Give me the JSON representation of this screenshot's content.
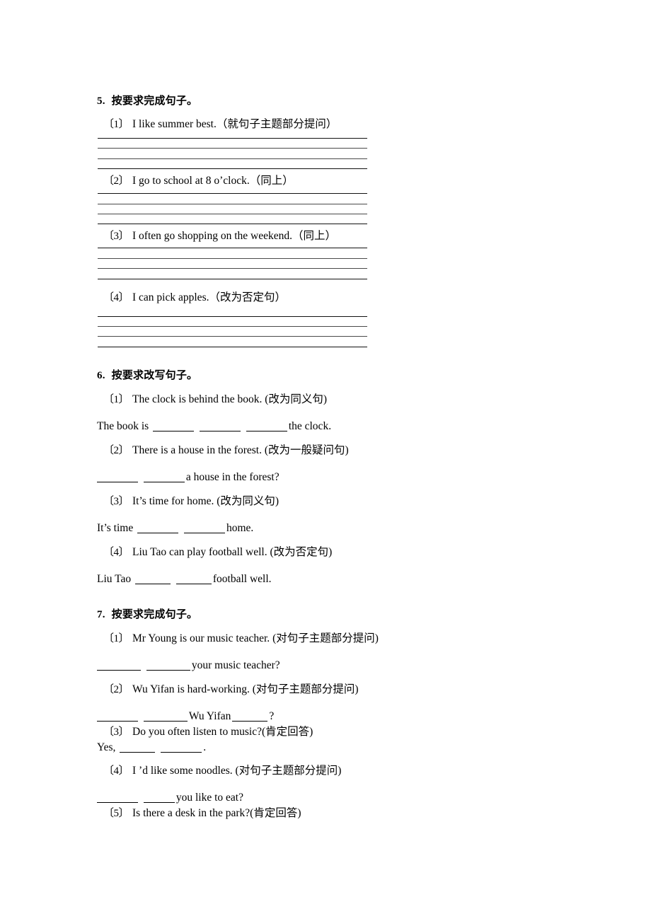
{
  "document": {
    "type": "worksheet-page",
    "language": "zh-CN/en"
  },
  "sections": [
    {
      "number": "5.",
      "title": "按要求完成句子。",
      "items": [
        {
          "index": "〔1〕",
          "stem": "I like summer best.",
          "note": "（就句子主题部分提问）"
        },
        {
          "index": "〔2〕",
          "stem": "I go to school at 8 o’clock.",
          "note": "（同上）"
        },
        {
          "index": "〔3〕",
          "stem": "I often go shopping on the weekend.",
          "note": "（同上）"
        },
        {
          "index": "〔4〕",
          "stem": "I can pick apples.",
          "note": "（改为否定句）"
        }
      ]
    },
    {
      "number": "6.",
      "title": "按要求改写句子。",
      "items": [
        {
          "index": "〔1〕",
          "stem": "The clock is behind the book.",
          "note": "(改为同义句)",
          "answer_pre": "The book is",
          "answer_post": "the clock.",
          "blank_count": 3
        },
        {
          "index": "〔2〕",
          "stem": "There is a house in the forest.",
          "note": "(改为一般疑问句)",
          "answer_pre": "",
          "answer_post": "a house in the forest?",
          "blank_count": 2
        },
        {
          "index": "〔3〕",
          "stem": "It’s time for home.",
          "note": "(改为同义句)",
          "answer_pre": "It’s time",
          "answer_post": "home.",
          "blank_count": 2
        },
        {
          "index": "〔4〕",
          "stem": "Liu Tao can play football well.",
          "note": "(改为否定句)",
          "answer_pre": "Liu Tao",
          "answer_post": "football well.",
          "blank_count": 2
        }
      ]
    },
    {
      "number": "7.",
      "title": "按要求完成句子。",
      "items": [
        {
          "index": "〔1〕",
          "stem": "Mr Young is our music teacher.",
          "note": "(对句子主题部分提问)",
          "answer_pre": "",
          "answer_mid": "",
          "answer_post": "your music teacher?",
          "blank_count": 2
        },
        {
          "index": "〔2〕",
          "stem": "Wu Yifan is hard-working.",
          "note": "(对句子主题部分提问)",
          "answer_pre": "",
          "answer_mid": "Wu Yifan",
          "answer_post": "?",
          "blank_count": 3
        },
        {
          "index": "〔3〕",
          "stem": "Do you often listen to music?",
          "note": "(肯定回答)",
          "answer_pre": "Yes,",
          "answer_post": ".",
          "blank_count": 2
        },
        {
          "index": "〔4〕",
          "stem": "I ’d like some noodles.",
          "note": "(对句子主题部分提问)",
          "answer_pre": "",
          "answer_post": "you like to eat?",
          "blank_count": 2
        },
        {
          "index": "〔5〕",
          "stem": "Is there a desk in the park?",
          "note": "(肯定回答)"
        }
      ]
    }
  ]
}
